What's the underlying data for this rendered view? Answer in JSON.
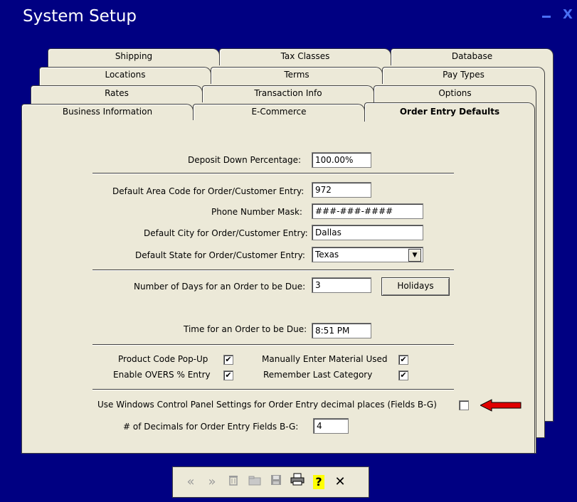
{
  "window": {
    "title": "System Setup",
    "minimize": "_",
    "close": "X"
  },
  "tabs": {
    "row1": [
      "Shipping",
      "Tax Classes",
      "Database"
    ],
    "row2": [
      "Locations",
      "Terms",
      "Pay Types"
    ],
    "row3": [
      "Rates",
      "Transaction Info",
      "Options"
    ],
    "row4": [
      "Business Information",
      "E-Commerce",
      "Order Entry Defaults"
    ]
  },
  "form": {
    "deposit_label": "Deposit Down Percentage:",
    "deposit_value": "100.00%",
    "area_code_label": "Default Area Code for Order/Customer Entry:",
    "area_code_value": "972",
    "phone_mask_label": "Phone Number Mask:",
    "phone_mask_value": "###-###-####",
    "city_label": "Default City for Order/Customer Entry:",
    "city_value": "Dallas",
    "state_label": "Default State for Order/Customer Entry:",
    "state_value": "Texas",
    "days_label": "Number of Days for an Order to be Due:",
    "days_value": "3",
    "holidays_button": "Holidays",
    "time_label": "Time for an Order to be Due:",
    "time_value": "8:51 PM",
    "product_popup_label": "Product Code Pop-Up",
    "product_popup_checked": "✔",
    "manual_material_label": "Manually Enter Material Used",
    "manual_material_checked": "✔",
    "overs_label": "Enable OVERS % Entry",
    "overs_checked": "✔",
    "remember_category_label": "Remember Last Category",
    "remember_category_checked": "✔",
    "windows_settings_label": "Use Windows Control Panel Settings for Order Entry decimal places (Fields B-G)",
    "decimals_label": "# of Decimals for Order Entry Fields B-G:",
    "decimals_value": "4"
  },
  "toolbar": {
    "first": "«",
    "next": "»",
    "delete": "🗑",
    "folder": "▣",
    "save": "■",
    "print": "⎙",
    "help": "?",
    "close": "✕"
  },
  "colors": {
    "title_bar": "#000082",
    "panel": "#ece9d8",
    "arrow": "#e00000"
  }
}
